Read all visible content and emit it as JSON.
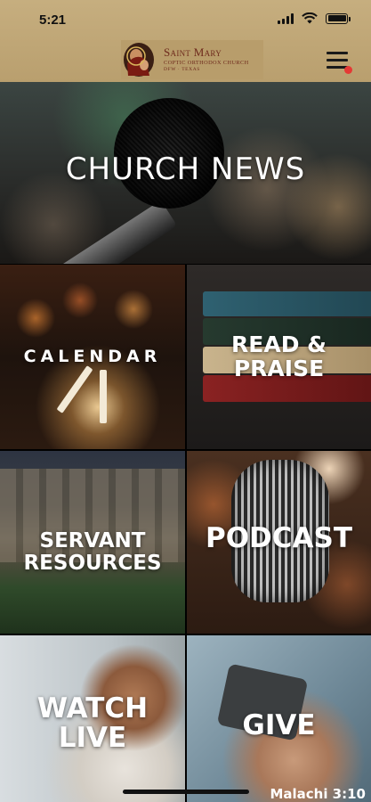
{
  "status_bar": {
    "time": "5:21"
  },
  "header": {
    "logo_title": "Saint Mary",
    "logo_subtitle": "Coptic Orthodox Church",
    "logo_location": "DFW · Texas",
    "menu_icon": "hamburger-menu-icon",
    "notification_dot_color": "#e53935"
  },
  "tiles": {
    "church_news": "CHURCH NEWS",
    "calendar": "CALENDAR",
    "read_praise_line1": "READ &",
    "read_praise_line2": "PRAISE",
    "servant_line1": "SERVANT",
    "servant_line2": "RESOURCES",
    "podcast": "PODCAST",
    "watch_line1": "WATCH",
    "watch_line2": "LIVE",
    "give": "GIVE",
    "give_verse": "Malachi 3:10"
  },
  "colors": {
    "header_bg": "#c6ae7f",
    "logo_text": "#6e2a1c"
  }
}
